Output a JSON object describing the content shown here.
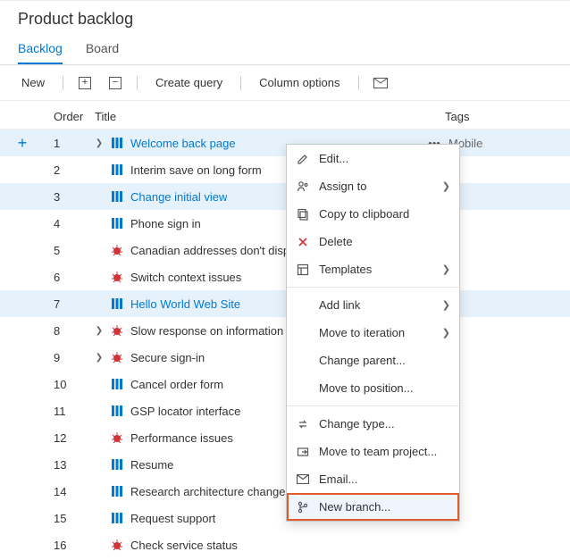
{
  "header": {
    "title": "Product backlog"
  },
  "tabs": [
    {
      "label": "Backlog",
      "active": true
    },
    {
      "label": "Board",
      "active": false
    }
  ],
  "toolbar": {
    "new_label": "New",
    "create_query_label": "Create query",
    "column_options_label": "Column options"
  },
  "columns": {
    "order": "Order",
    "title": "Title",
    "tags": "Tags"
  },
  "rows": [
    {
      "order": "1",
      "expandable": true,
      "type": "pbi",
      "title": "Welcome back page",
      "tags": "Mobile",
      "selected": true,
      "link": true,
      "menu_open": true
    },
    {
      "order": "2",
      "expandable": false,
      "type": "pbi",
      "title": "Interim save on long form",
      "tags": "",
      "selected": false,
      "link": false
    },
    {
      "order": "3",
      "expandable": false,
      "type": "pbi",
      "title": "Change initial view",
      "tags": "",
      "selected": true,
      "link": true
    },
    {
      "order": "4",
      "expandable": false,
      "type": "pbi",
      "title": "Phone sign in",
      "tags": "",
      "selected": false,
      "link": false
    },
    {
      "order": "5",
      "expandable": false,
      "type": "bug",
      "title": "Canadian addresses don't disp",
      "tags": "",
      "selected": false,
      "link": false
    },
    {
      "order": "6",
      "expandable": false,
      "type": "bug",
      "title": "Switch context issues",
      "tags": "",
      "selected": false,
      "link": false
    },
    {
      "order": "7",
      "expandable": false,
      "type": "pbi",
      "title": "Hello World Web Site",
      "tags": "",
      "selected": true,
      "link": true
    },
    {
      "order": "8",
      "expandable": true,
      "type": "bug",
      "title": "Slow response on information",
      "tags": "",
      "selected": false,
      "link": false
    },
    {
      "order": "9",
      "expandable": true,
      "type": "bug",
      "title": "Secure sign-in",
      "tags": "",
      "selected": false,
      "link": false
    },
    {
      "order": "10",
      "expandable": false,
      "type": "pbi",
      "title": "Cancel order form",
      "tags": "",
      "selected": false,
      "link": false
    },
    {
      "order": "11",
      "expandable": false,
      "type": "pbi",
      "title": "GSP locator interface",
      "tags": "",
      "selected": false,
      "link": false
    },
    {
      "order": "12",
      "expandable": false,
      "type": "bug",
      "title": "Performance issues",
      "tags": "",
      "selected": false,
      "link": false
    },
    {
      "order": "13",
      "expandable": false,
      "type": "pbi",
      "title": "Resume",
      "tags": "",
      "selected": false,
      "link": false
    },
    {
      "order": "14",
      "expandable": false,
      "type": "pbi",
      "title": "Research architecture changes",
      "tags": "",
      "selected": false,
      "link": false
    },
    {
      "order": "15",
      "expandable": false,
      "type": "pbi",
      "title": "Request support",
      "tags": "",
      "selected": false,
      "link": false
    },
    {
      "order": "16",
      "expandable": false,
      "type": "bug",
      "title": "Check service status",
      "tags": "",
      "selected": false,
      "link": false
    }
  ],
  "context_menu": {
    "items": [
      {
        "icon": "edit",
        "label": "Edit...",
        "submenu": false
      },
      {
        "icon": "assign",
        "label": "Assign to",
        "submenu": true
      },
      {
        "icon": "copy",
        "label": "Copy to clipboard",
        "submenu": false
      },
      {
        "icon": "delete",
        "label": "Delete",
        "submenu": false
      },
      {
        "icon": "templates",
        "label": "Templates",
        "submenu": true
      },
      {
        "sep": true
      },
      {
        "icon": "",
        "label": "Add link",
        "submenu": true
      },
      {
        "icon": "",
        "label": "Move to iteration",
        "submenu": true
      },
      {
        "icon": "",
        "label": "Change parent...",
        "submenu": false
      },
      {
        "icon": "",
        "label": "Move to position...",
        "submenu": false
      },
      {
        "sep": true
      },
      {
        "icon": "changetype",
        "label": "Change type...",
        "submenu": false
      },
      {
        "icon": "moveproj",
        "label": "Move to team project...",
        "submenu": false
      },
      {
        "icon": "mail",
        "label": "Email...",
        "submenu": false
      },
      {
        "icon": "branch",
        "label": "New branch...",
        "submenu": false,
        "highlight": true
      }
    ]
  }
}
